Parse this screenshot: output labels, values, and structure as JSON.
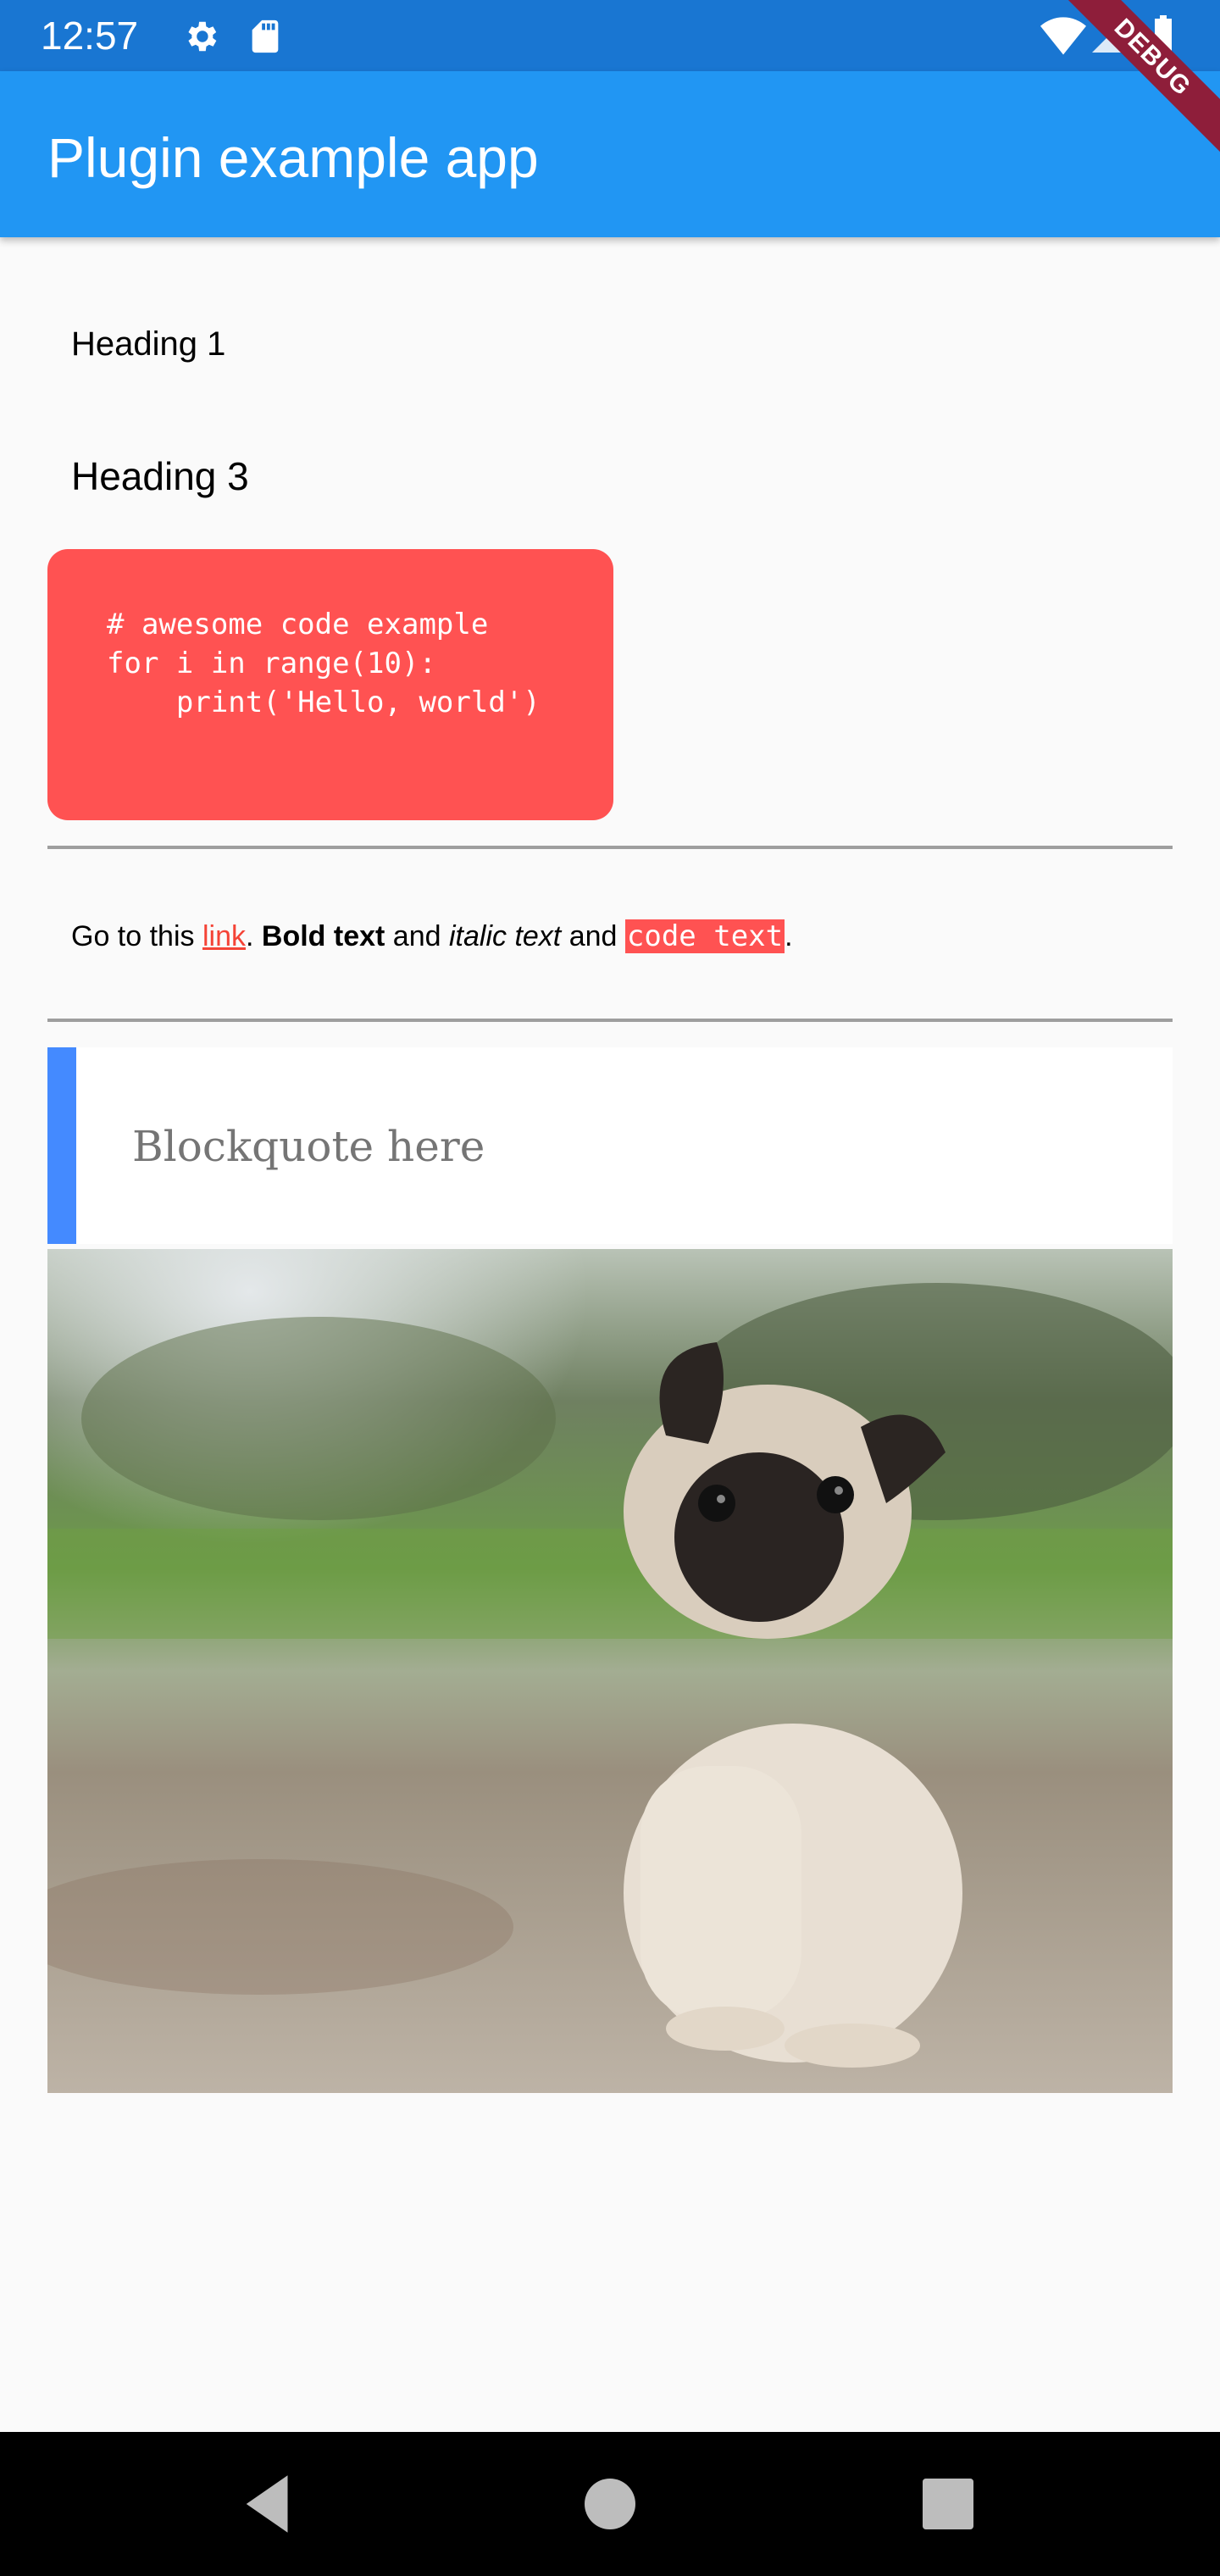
{
  "status_bar": {
    "time": "12:57",
    "left_icons": [
      "settings-icon",
      "sd-card-icon"
    ],
    "right_icons": [
      "wifi-icon",
      "cellular-signal-icon",
      "battery-icon"
    ]
  },
  "debug_banner": "DEBUG",
  "app_bar": {
    "title": "Plugin example app"
  },
  "content": {
    "heading1": "Heading 1",
    "heading3": "Heading 3",
    "code_block": "# awesome code example\nfor i in range(10):\n    print('Hello, world')",
    "paragraph": {
      "go_to": "Go to this ",
      "link": "link",
      "after_link": ". ",
      "bold": "Bold text",
      "and1": " and ",
      "italic": "italic text",
      "and2": " and ",
      "code": "code text",
      "end": "."
    },
    "blockquote": "Blockquote here",
    "image_subject": "pug-puppy-photo"
  },
  "colors": {
    "status_bar": "#1976d2",
    "app_bar": "#2196f3",
    "code_bg": "#ff5252",
    "link": "#f44336",
    "blockquote_bar": "#448aff",
    "debug_ribbon": "#8e1e3a"
  },
  "nav_bar": {
    "buttons": [
      "back-icon",
      "home-icon",
      "recents-icon"
    ]
  }
}
